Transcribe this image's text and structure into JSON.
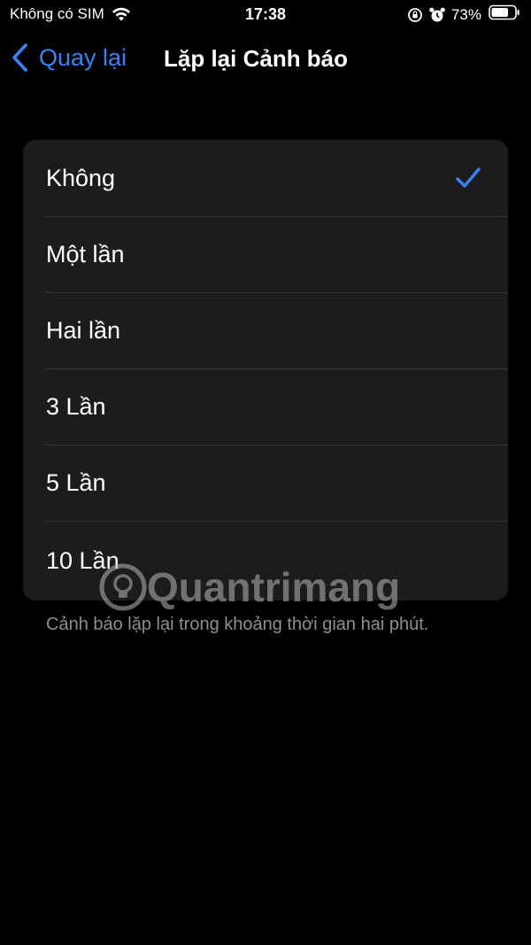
{
  "status_bar": {
    "carrier": "Không có SIM",
    "time": "17:38",
    "battery_percent": "73%",
    "icons": [
      "wifi-icon",
      "rotation-lock-icon",
      "alarm-icon",
      "battery-icon"
    ]
  },
  "nav": {
    "back_label": "Quay lại",
    "title": "Lặp lại Cảnh báo",
    "accent_color": "#3b82f6"
  },
  "options": [
    {
      "label": "Không",
      "selected": true
    },
    {
      "label": "Một lần",
      "selected": false
    },
    {
      "label": "Hai lần",
      "selected": false
    },
    {
      "label": "3 Lần",
      "selected": false
    },
    {
      "label": "5 Lần",
      "selected": false
    },
    {
      "label": "10 Lần",
      "selected": false
    }
  ],
  "footer_note": "Cảnh báo lặp lại trong khoảng thời gian hai phút.",
  "watermark": "Quantrimang"
}
